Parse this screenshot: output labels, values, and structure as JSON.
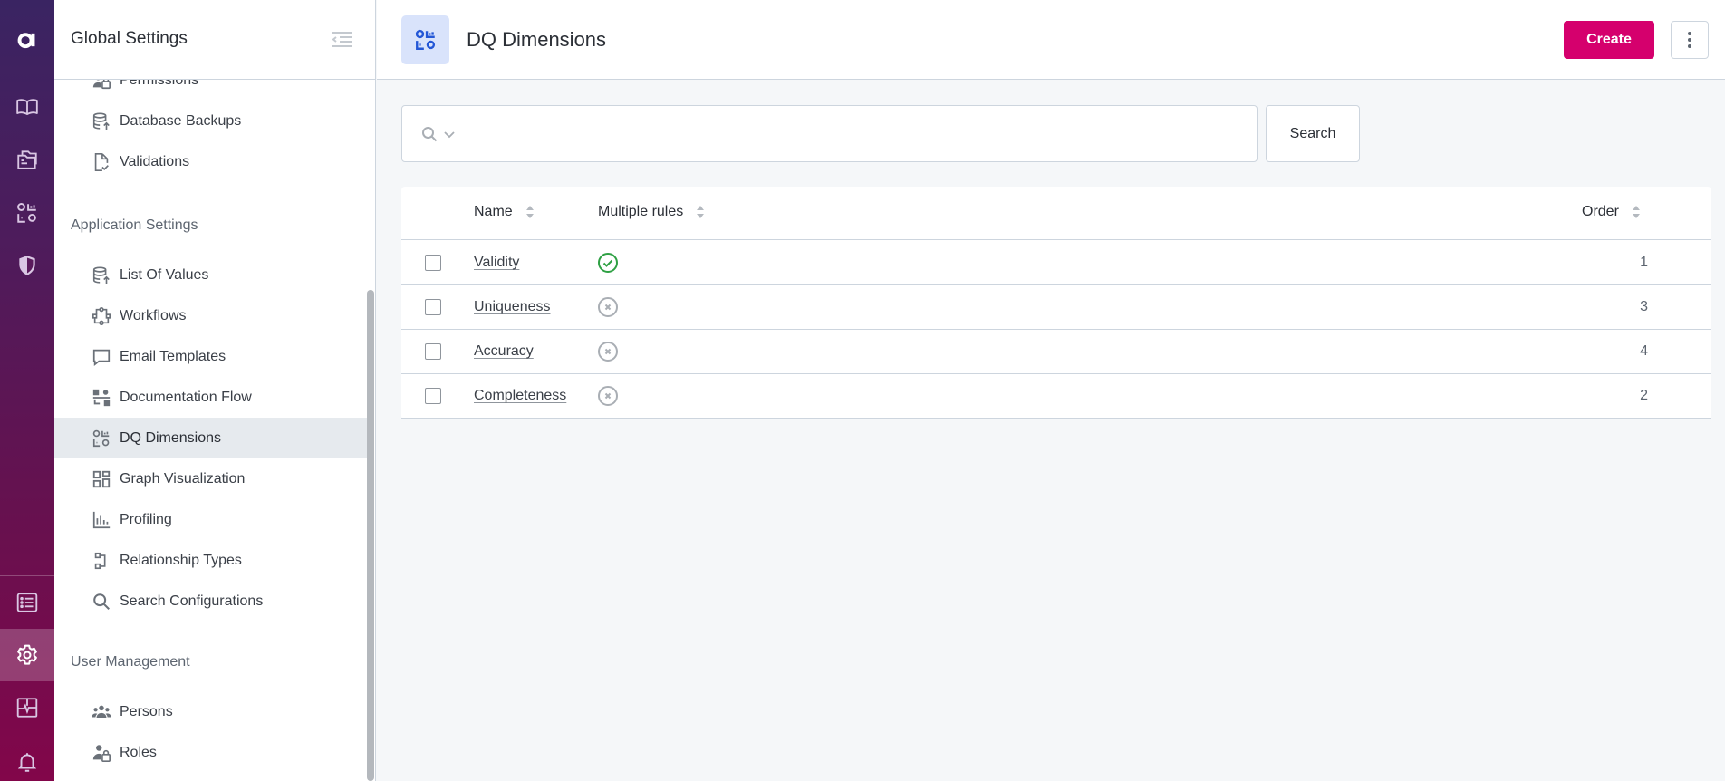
{
  "rail": {
    "logo": "a",
    "items": [
      {
        "name": "glossary-icon",
        "active": false
      },
      {
        "name": "catalog-icon",
        "active": false
      },
      {
        "name": "dq-icon",
        "active": false
      },
      {
        "name": "governance-shield-icon",
        "active": false
      },
      {
        "name": "tasks-list-icon",
        "active": false
      },
      {
        "name": "settings-gear-icon",
        "active": true
      },
      {
        "name": "monitoring-icon",
        "active": false
      },
      {
        "name": "notifications-bell-icon",
        "active": false
      }
    ]
  },
  "sidebar": {
    "title": "Global Settings",
    "sections": [
      {
        "title": null,
        "items": [
          {
            "label": "Permissions",
            "icon": "permissions-icon"
          },
          {
            "label": "Database Backups",
            "icon": "database-backup-icon"
          },
          {
            "label": "Validations",
            "icon": "validations-icon"
          }
        ]
      },
      {
        "title": "Application Settings",
        "items": [
          {
            "label": "List Of Values",
            "icon": "list-of-values-icon"
          },
          {
            "label": "Workflows",
            "icon": "workflows-icon"
          },
          {
            "label": "Email Templates",
            "icon": "email-templates-icon"
          },
          {
            "label": "Documentation Flow",
            "icon": "documentation-flow-icon"
          },
          {
            "label": "DQ Dimensions",
            "icon": "dq-dimensions-icon",
            "active": true
          },
          {
            "label": "Graph Visualization",
            "icon": "graph-visualization-icon"
          },
          {
            "label": "Profiling",
            "icon": "profiling-icon"
          },
          {
            "label": "Relationship Types",
            "icon": "relationship-types-icon"
          },
          {
            "label": "Search Configurations",
            "icon": "search-configurations-icon"
          }
        ]
      },
      {
        "title": "User Management",
        "items": [
          {
            "label": "Persons",
            "icon": "persons-icon"
          },
          {
            "label": "Roles",
            "icon": "roles-icon"
          }
        ]
      }
    ]
  },
  "header": {
    "title": "DQ Dimensions",
    "create_label": "Create"
  },
  "search": {
    "value": "",
    "placeholder": "",
    "button_label": "Search"
  },
  "table": {
    "columns": [
      "Name",
      "Multiple rules",
      "Order"
    ],
    "rows": [
      {
        "name": "Validity",
        "multiple_rules": true,
        "order": "1"
      },
      {
        "name": "Uniqueness",
        "multiple_rules": false,
        "order": "3"
      },
      {
        "name": "Accuracy",
        "multiple_rules": false,
        "order": "4"
      },
      {
        "name": "Completeness",
        "multiple_rules": false,
        "order": "2"
      }
    ]
  },
  "colors": {
    "accent": "#d5006d",
    "check_green": "#2ea043",
    "cross_grey": "#a9aeb4",
    "page_icon_bg": "#d9e3fb",
    "page_icon_fg": "#2457d6"
  }
}
